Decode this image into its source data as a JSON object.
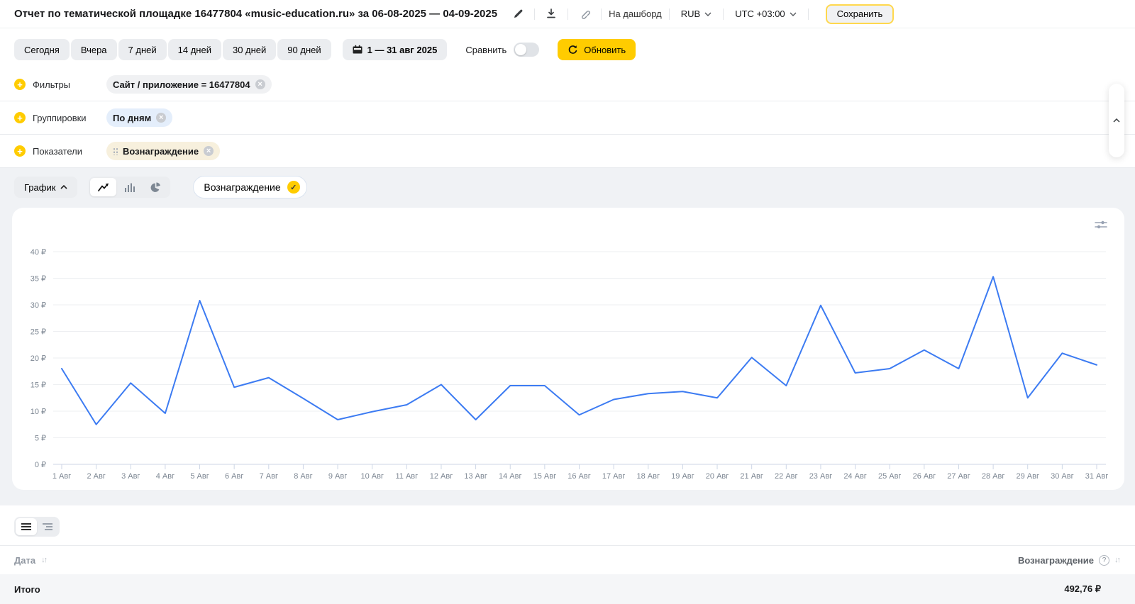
{
  "header": {
    "title": "Отчет по тематической площадке 16477804 «music-education.ru» за 06-08-2025 — 04-09-2025",
    "dashboard_link": "На дашборд",
    "currency": "RUB",
    "timezone": "UTC +03:00",
    "save_label": "Сохранить"
  },
  "toolbar": {
    "presets": [
      "Сегодня",
      "Вчера",
      "7 дней",
      "14 дней",
      "30 дней",
      "90 дней"
    ],
    "date_range": "1 — 31 авг 2025",
    "compare_label": "Сравнить",
    "refresh_label": "Обновить"
  },
  "rows": {
    "filters_label": "Фильтры",
    "filter_chip": "Сайт / приложение = 16477804",
    "groupings_label": "Группировки",
    "grouping_chip": "По дням",
    "metrics_label": "Показатели",
    "metric_chip": "Вознаграждение"
  },
  "chart_controls": {
    "chart_label": "График",
    "metric_selector": "Вознаграждение"
  },
  "table": {
    "date_header": "Дата",
    "metric_header": "Вознаграждение",
    "total_label": "Итого",
    "total_value": "492,76 ₽"
  },
  "chart_data": {
    "type": "line",
    "title": "",
    "x": [
      "1 Авг",
      "2 Авг",
      "3 Авг",
      "4 Авг",
      "5 Авг",
      "6 Авг",
      "7 Авг",
      "8 Авг",
      "9 Авг",
      "10 Авг",
      "11 Авг",
      "12 Авг",
      "13 Авг",
      "14 Авг",
      "15 Авг",
      "16 Авг",
      "17 Авг",
      "18 Авг",
      "19 Авг",
      "20 Авг",
      "21 Авг",
      "22 Авг",
      "23 Авг",
      "24 Авг",
      "25 Авг",
      "26 Авг",
      "27 Авг",
      "28 Авг",
      "29 Авг",
      "30 Авг",
      "31 Авг"
    ],
    "series": [
      {
        "name": "Вознаграждение",
        "values": [
          18.0,
          7.5,
          15.3,
          9.6,
          30.8,
          14.5,
          16.3,
          12.4,
          8.4,
          9.9,
          11.2,
          15.0,
          8.4,
          14.8,
          14.8,
          9.3,
          12.2,
          13.3,
          13.7,
          12.5,
          20.1,
          14.8,
          29.9,
          17.2,
          18.0,
          21.5,
          18.0,
          35.3,
          12.5,
          20.9,
          18.7
        ]
      }
    ],
    "ylim": [
      0,
      40
    ],
    "ytick_step": 5,
    "y_unit": "₽",
    "grid": true,
    "legend_position": "none",
    "line_color": "#3c7bf2",
    "grid_color": "#edeff2",
    "axis_color": "#cdd6e6",
    "tick_text_color": "#7d8793"
  },
  "colors": {
    "accent_yellow": "#ffcc00",
    "section_bg": "#f0f2f5"
  }
}
